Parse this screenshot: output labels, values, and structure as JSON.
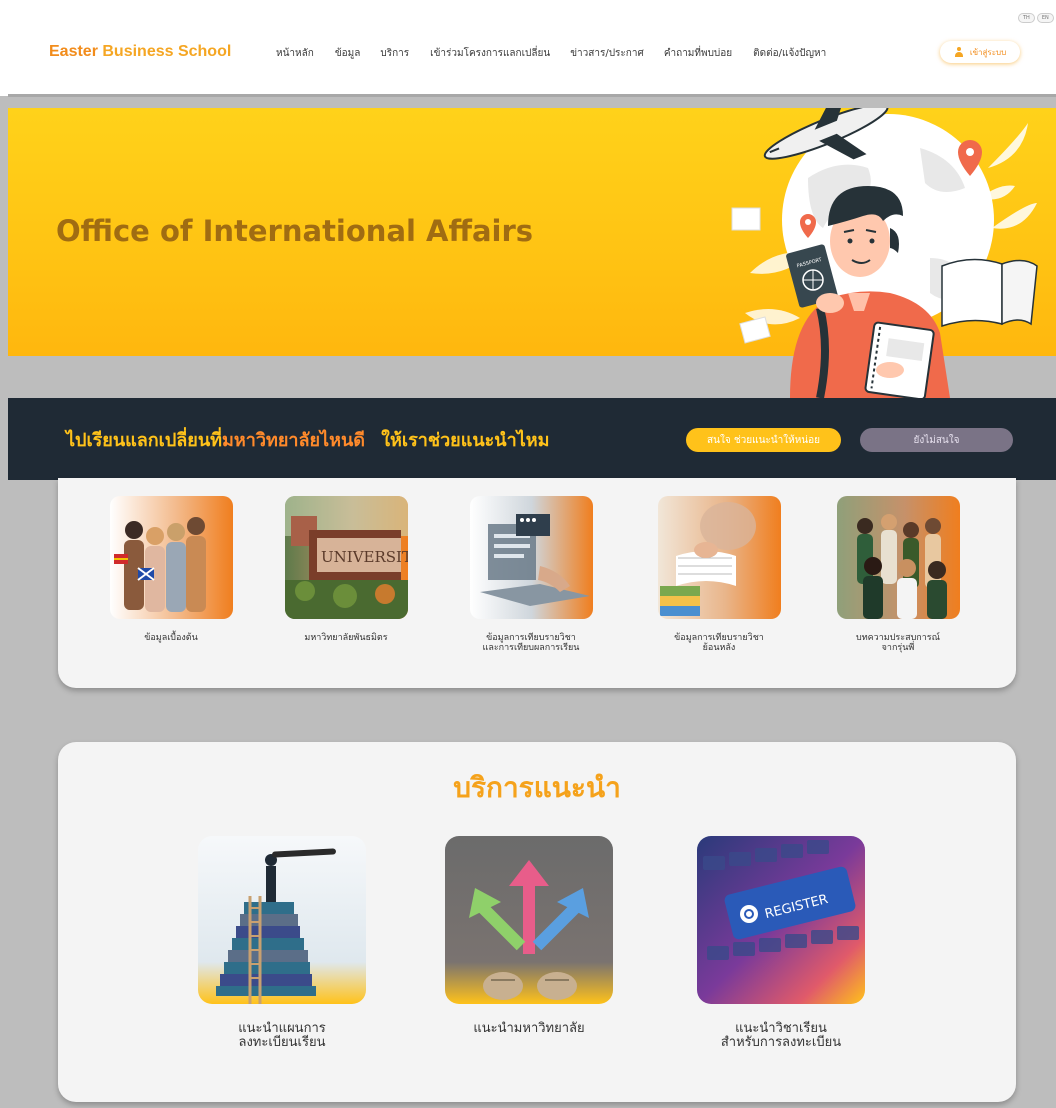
{
  "header": {
    "logo_part1": "Easter",
    "logo_part2": "Business School",
    "nav": [
      "หน้าหลัก",
      "ข้อมูล",
      "บริการ",
      "เข้าร่วมโครงการแลกเปลี่ยน",
      "ข่าวสาร/ประกาศ",
      "คำถามที่พบบ่อย",
      "ติดต่อ/แจ้งปัญหา"
    ],
    "login_label": "เข้าสู่ระบบ",
    "lang_th": "TH",
    "lang_en": "EN"
  },
  "hero": {
    "title": "Office of International Affairs",
    "passport_text": "PASSPORT"
  },
  "band": {
    "text_part1": "ไปเรียนแลกเปลี่ยนที่",
    "text_part2": "มหาวิทยาลัยไหนดี",
    "text_part3": "ให้เราช่วยแนะนำไหม",
    "btn_interested": "สนใจ ช่วยแนะนำให้หน่อย",
    "btn_not_interested": "ยังไม่สนใจ"
  },
  "info": {
    "items": [
      {
        "label": "ข้อมูลเบื้องต้น",
        "icon": "students-photo"
      },
      {
        "label": "มหาวิทยาลัยพันธมิตร",
        "icon": "university-sign-photo",
        "sign_text": "UNIVERSITY"
      },
      {
        "label": "ข้อมูลการเทียบรายวิชา\nและการเทียบผลการเรียน",
        "icon": "laptop-documents-photo"
      },
      {
        "label": "ข้อมูลการเทียบรายวิชา\nย้อนหลัง",
        "icon": "studying-books-photo"
      },
      {
        "label": "บทความประสบการณ์\nจากรุ่นพี่",
        "icon": "group-students-photo"
      }
    ]
  },
  "services": {
    "title": "บริการแนะนำ",
    "items": [
      {
        "label": "แนะนำแผนการ\nลงทะเบียนเรียน",
        "icon": "telescope-books-photo"
      },
      {
        "label": "แนะนำมหาวิทยาลัย",
        "icon": "chalk-arrows-photo"
      },
      {
        "label": "แนะนำวิชาเรียน\nสำหรับการลงทะเบียน",
        "icon": "register-keyboard-photo",
        "key_text": "REGISTER"
      }
    ]
  },
  "colors": {
    "accent": "#f5a623",
    "hero_yellow": "#ffc313",
    "band_dark": "#1f2a35",
    "orange": "#ff8a2b"
  }
}
